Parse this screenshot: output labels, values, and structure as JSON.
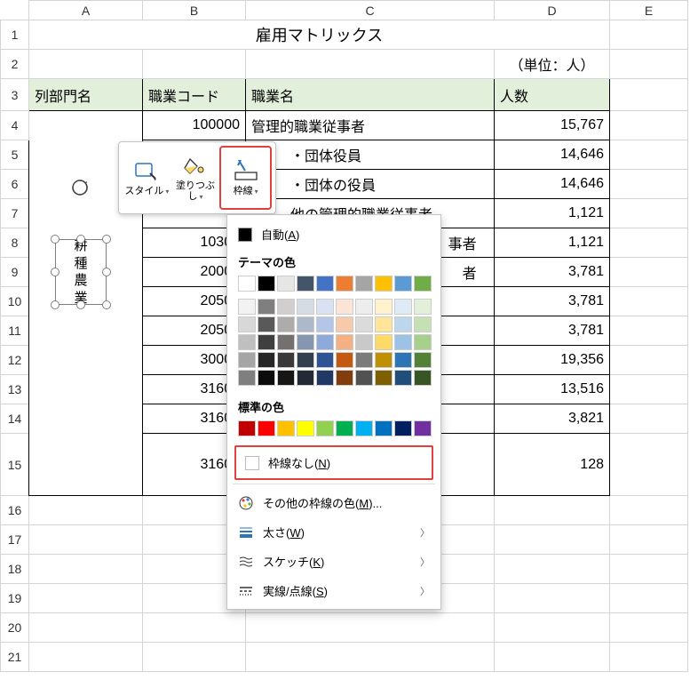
{
  "columns": [
    "A",
    "B",
    "C",
    "D",
    "E"
  ],
  "rows": [
    "1",
    "2",
    "3",
    "4",
    "5",
    "6",
    "7",
    "8",
    "9",
    "10",
    "11",
    "12",
    "13",
    "14",
    "15",
    "16",
    "17",
    "18",
    "19",
    "20",
    "21"
  ],
  "col_widths": {
    "row": 32,
    "A": 128,
    "B": 116,
    "C": 280,
    "D": 130,
    "E": 88
  },
  "title": "雇用マトリックス",
  "unit_label": "（単位：人）",
  "headers": {
    "a": "列部門名",
    "b": "職業コード",
    "c": "職業名",
    "d": "人数"
  },
  "table_rows": [
    {
      "code": "100000",
      "name": "管理的職業従事者",
      "count": "15,767"
    },
    {
      "code": "",
      "name": "・団体役員",
      "count": "14,646"
    },
    {
      "code": "",
      "name": "・団体の役員",
      "count": "14,646"
    },
    {
      "code": "",
      "name": "他の管理的職業従事者",
      "count": "1,121"
    },
    {
      "code": "10300",
      "name_suffix": "事者",
      "count": "1,121"
    },
    {
      "code": "20000",
      "name_suffix": "者",
      "count": "3,781"
    },
    {
      "code": "20500",
      "name": "",
      "count": "3,781"
    },
    {
      "code": "20500",
      "name": "",
      "count": "3,781"
    },
    {
      "code": "30000",
      "name": "",
      "count": "19,356"
    },
    {
      "code": "31600",
      "name": "",
      "count": "13,516"
    },
    {
      "code": "31606",
      "name": "",
      "count": "3,821"
    },
    {
      "code": "31607",
      "name": "",
      "count": "128"
    }
  ],
  "shape_text": "耕種農業",
  "mini_toolbar": {
    "style": "スタイル",
    "fill": "塗りつぶし",
    "border": "枠線"
  },
  "dropdown": {
    "auto": "自動",
    "auto_key": "A",
    "theme_colors": "テーマの色",
    "standard_colors": "標準の色",
    "no_border": "枠線なし",
    "no_border_key": "N",
    "more_colors": "その他の枠線の色",
    "more_colors_key": "M",
    "weight": "太さ",
    "weight_key": "W",
    "sketch": "スケッチ",
    "sketch_key": "K",
    "dashes": "実線/点線",
    "dashes_key": "S",
    "theme_row1": [
      "#ffffff",
      "#000000",
      "#e7e6e6",
      "#44546a",
      "#4472c4",
      "#ed7d31",
      "#a5a5a5",
      "#ffc000",
      "#5b9bd5",
      "#70ad47"
    ],
    "theme_shades": [
      [
        "#f2f2f2",
        "#7f7f7f",
        "#d0cece",
        "#d6dce4",
        "#d9e1f2",
        "#fbe4d5",
        "#ededed",
        "#fff2cc",
        "#deeaf6",
        "#e2efd9"
      ],
      [
        "#d8d8d8",
        "#595959",
        "#aeabab",
        "#adb9ca",
        "#b4c6e7",
        "#f7caac",
        "#dbdbdb",
        "#fee599",
        "#bdd6ee",
        "#c5e0b3"
      ],
      [
        "#bfbfbf",
        "#3f3f3f",
        "#757070",
        "#8496b0",
        "#8eaadb",
        "#f4b083",
        "#c9c9c9",
        "#ffd965",
        "#9cc2e5",
        "#a8d08d"
      ],
      [
        "#a5a5a5",
        "#262626",
        "#3a3838",
        "#323f4f",
        "#2f5496",
        "#c45911",
        "#7b7b7b",
        "#bf9000",
        "#2e75b5",
        "#538135"
      ],
      [
        "#7f7f7f",
        "#0c0c0c",
        "#171616",
        "#222a35",
        "#1f3864",
        "#833c0b",
        "#525252",
        "#7f6000",
        "#1e4e79",
        "#375623"
      ]
    ],
    "standard_row": [
      "#c00000",
      "#ff0000",
      "#ffc000",
      "#ffff00",
      "#92d050",
      "#00b050",
      "#00b0f0",
      "#0070c0",
      "#002060",
      "#7030a0"
    ]
  }
}
